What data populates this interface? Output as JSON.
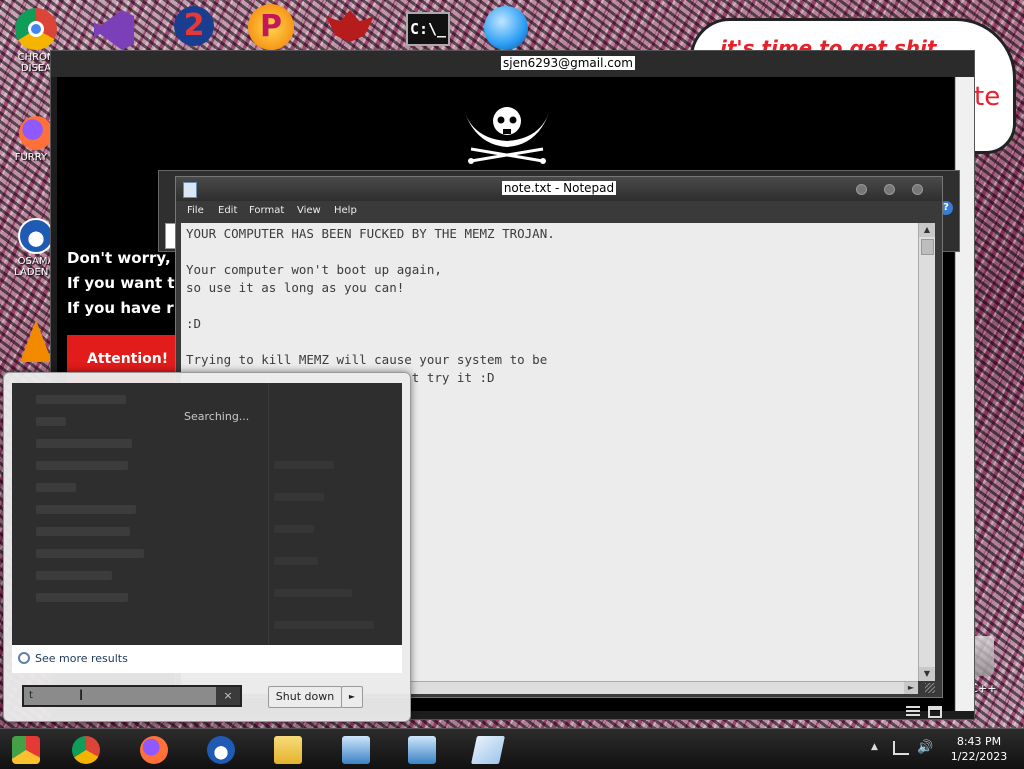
{
  "desktop": {
    "icons": [
      {
        "label": "CHRON DISEA",
        "name": "desktop-icon-chrome",
        "color": "#db4437"
      },
      {
        "label": "FURRY C",
        "name": "desktop-icon-firefox",
        "color": "#ff7139"
      },
      {
        "label": "OSAMA LADEN E",
        "name": "desktop-icon-obama",
        "color": "#1f5bb5"
      },
      {
        "label": "",
        "name": "desktop-icon-vlc",
        "color": "#f28a00"
      }
    ],
    "top_icons": [
      {
        "name": "top-icon-visual-studio",
        "color": "#7b3fb8"
      },
      {
        "name": "top-icon-2",
        "color": "#c8262b"
      },
      {
        "name": "top-icon-p",
        "color": "#f59d1a"
      },
      {
        "name": "top-icon-red-logo",
        "color": "#b71c1c"
      },
      {
        "name": "top-icon-cmd",
        "color": "#111111"
      },
      {
        "name": "top-icon-globe",
        "color": "#2a9df4"
      }
    ],
    "bubble_text": "it's time to get shit",
    "bubble_fragment": "te",
    "cpp_label": "n C++"
  },
  "ransom_window": {
    "title": "sjen6293@gmail.com",
    "lines": [
      "Don't worry,",
      "If you want t",
      "If you have r"
    ],
    "attention": "Attention!"
  },
  "notepad": {
    "title": "note.txt - Notepad",
    "menu": [
      "File",
      "Edit",
      "Format",
      "View",
      "Help"
    ],
    "content": "YOUR COMPUTER HAS BEEN FUCKED BY THE MEMZ TROJAN.\n\nYour computer won't boot up again,\nso use it as long as you can!\n\n:D\n\nTrying to kill MEMZ will cause your system to be\n                              t try it :D"
  },
  "start_menu": {
    "searching": "Searching...",
    "see_more": "See more results",
    "search_value": "t",
    "clear": "×",
    "shutdown": "Shut down",
    "shutdown_arrow": "►"
  },
  "taskbar": {
    "apps": [
      {
        "name": "taskbar-chrome-alt",
        "color": "#e53935"
      },
      {
        "name": "taskbar-chrome",
        "color": "#34a853"
      },
      {
        "name": "taskbar-firefox",
        "color": "#ff7139"
      },
      {
        "name": "taskbar-obama",
        "color": "#1f5bb5"
      },
      {
        "name": "taskbar-explorer",
        "color": "#f3c74b"
      },
      {
        "name": "taskbar-network-1",
        "color": "#3b82c4"
      },
      {
        "name": "taskbar-network-2",
        "color": "#3b82c4"
      },
      {
        "name": "taskbar-notepad",
        "color": "#9fc7ea"
      }
    ],
    "tray_arrow": "▲",
    "volume": "🔊",
    "time": "8:43 PM",
    "date": "1/22/2023"
  }
}
